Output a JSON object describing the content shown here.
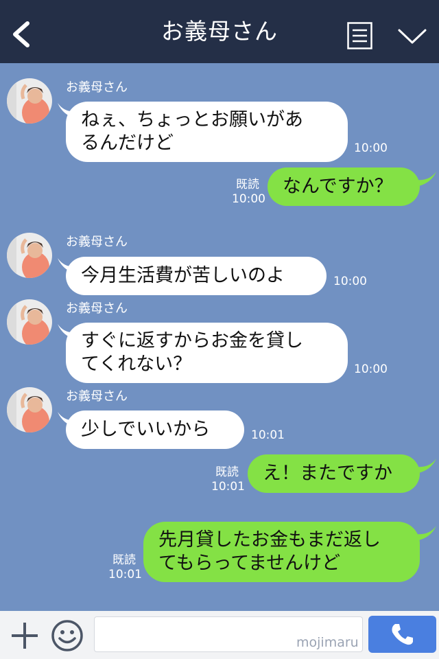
{
  "header": {
    "title": "お義母さん",
    "back_icon": "chevron-left-icon",
    "menu_icon": "menu-icon",
    "collapse_icon": "chevron-down-icon"
  },
  "messages": [
    {
      "side": "incoming",
      "sender": "お義母さん",
      "lines": [
        "ねぇ、ちょっとお願いがあ",
        "るんだけど"
      ],
      "time": "10:00"
    },
    {
      "side": "outgoing",
      "read": "既読",
      "lines": [
        "なんですか？"
      ],
      "time": "10:00"
    },
    {
      "side": "incoming",
      "sender": "お義母さん",
      "lines": [
        "今月生活費が苦しいのよ"
      ],
      "time": "10:00"
    },
    {
      "side": "incoming",
      "sender": "お義母さん",
      "lines": [
        "すぐに返すからお金を貸し",
        "てくれない？"
      ],
      "time": "10:00"
    },
    {
      "side": "incoming",
      "sender": "お義母さん",
      "lines": [
        "少しでいいから"
      ],
      "time": "10:01"
    },
    {
      "side": "outgoing",
      "read": "既読",
      "lines": [
        "え！またですか"
      ],
      "time": "10:01"
    },
    {
      "side": "outgoing",
      "read": "既読",
      "lines": [
        "先月貸したお金もまだ返し",
        "てもらってませんけど"
      ],
      "time": "10:01"
    }
  ],
  "input_bar": {
    "watermark": "mojimaru",
    "plus_icon": "plus-icon",
    "emoji_icon": "smile-icon",
    "call_icon": "phone-icon"
  },
  "colors": {
    "header_bg": "#242f47",
    "chat_bg": "#7191c2",
    "incoming_bubble": "#ffffff",
    "outgoing_bubble": "#84e145",
    "call_button": "#4a7fe0"
  }
}
